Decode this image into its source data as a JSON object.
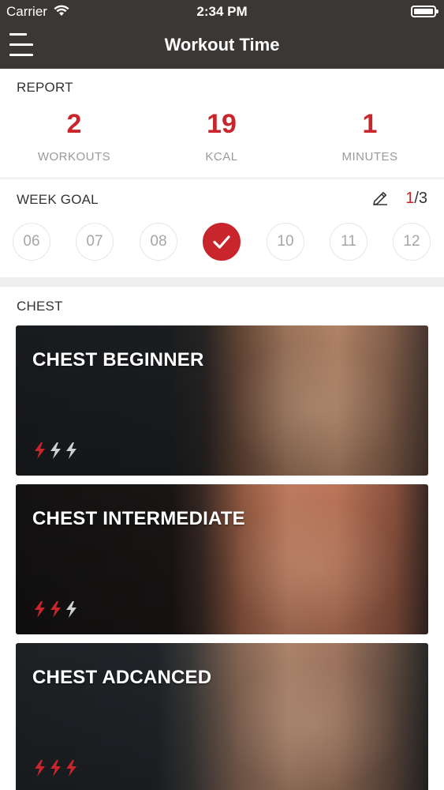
{
  "status_bar": {
    "carrier": "Carrier",
    "time": "2:34 PM"
  },
  "nav": {
    "title": "Workout Time",
    "menu_icon": "hamburger-menu-icon"
  },
  "report": {
    "label": "REPORT",
    "stats": [
      {
        "value": "2",
        "label": "WORKOUTS"
      },
      {
        "value": "19",
        "label": "KCAL"
      },
      {
        "value": "1",
        "label": "MINUTES"
      }
    ]
  },
  "week_goal": {
    "label": "WEEK GOAL",
    "edit_icon": "pencil-icon",
    "done": "1",
    "total": "/3",
    "days": [
      {
        "label": "06",
        "checked": false
      },
      {
        "label": "07",
        "checked": false
      },
      {
        "label": "08",
        "checked": false
      },
      {
        "label": "",
        "checked": true
      },
      {
        "label": "10",
        "checked": false
      },
      {
        "label": "11",
        "checked": false
      },
      {
        "label": "12",
        "checked": false
      }
    ]
  },
  "section": {
    "label": "CHEST"
  },
  "workouts": [
    {
      "title": "CHEST BEGINNER",
      "level": 1,
      "max_level": 3
    },
    {
      "title": "CHEST INTERMEDIATE",
      "level": 2,
      "max_level": 3
    },
    {
      "title": "CHEST ADCANCED",
      "level": 3,
      "max_level": 3
    }
  ],
  "colors": {
    "accent": "#c8262c",
    "nav_bg": "#3b3735",
    "muted": "#9a9a9a",
    "bolt_inactive": "#cfcfcf"
  }
}
